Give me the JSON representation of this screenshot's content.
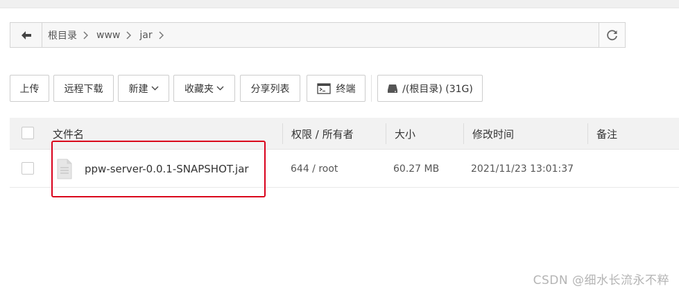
{
  "breadcrumb": {
    "items": [
      "根目录",
      "www",
      "jar"
    ]
  },
  "toolbar": {
    "upload": "上传",
    "remote_download": "远程下载",
    "new": "新建",
    "favorites": "收藏夹",
    "share_list": "分享列表",
    "terminal": "终端",
    "disk": "/(根目录) (31G)"
  },
  "table": {
    "columns": [
      "文件名",
      "权限 / 所有者",
      "大小",
      "修改时间",
      "备注"
    ],
    "rows": [
      {
        "name": "ppw-server-0.0.1-SNAPSHOT.jar",
        "permission": "644 / root",
        "size": "60.27 MB",
        "modified": "2021/11/23 13:01:37",
        "note": ""
      }
    ]
  },
  "watermark": "CSDN @细水长流永不粹",
  "colors": {
    "highlight": "#d9001b",
    "header_bg": "#f2f2f2",
    "border": "#d4d4d4"
  },
  "icons": [
    "back-arrow-icon",
    "chevron-right-icon",
    "refresh-icon",
    "chevron-down-icon",
    "terminal-icon",
    "disk-icon",
    "file-icon"
  ]
}
